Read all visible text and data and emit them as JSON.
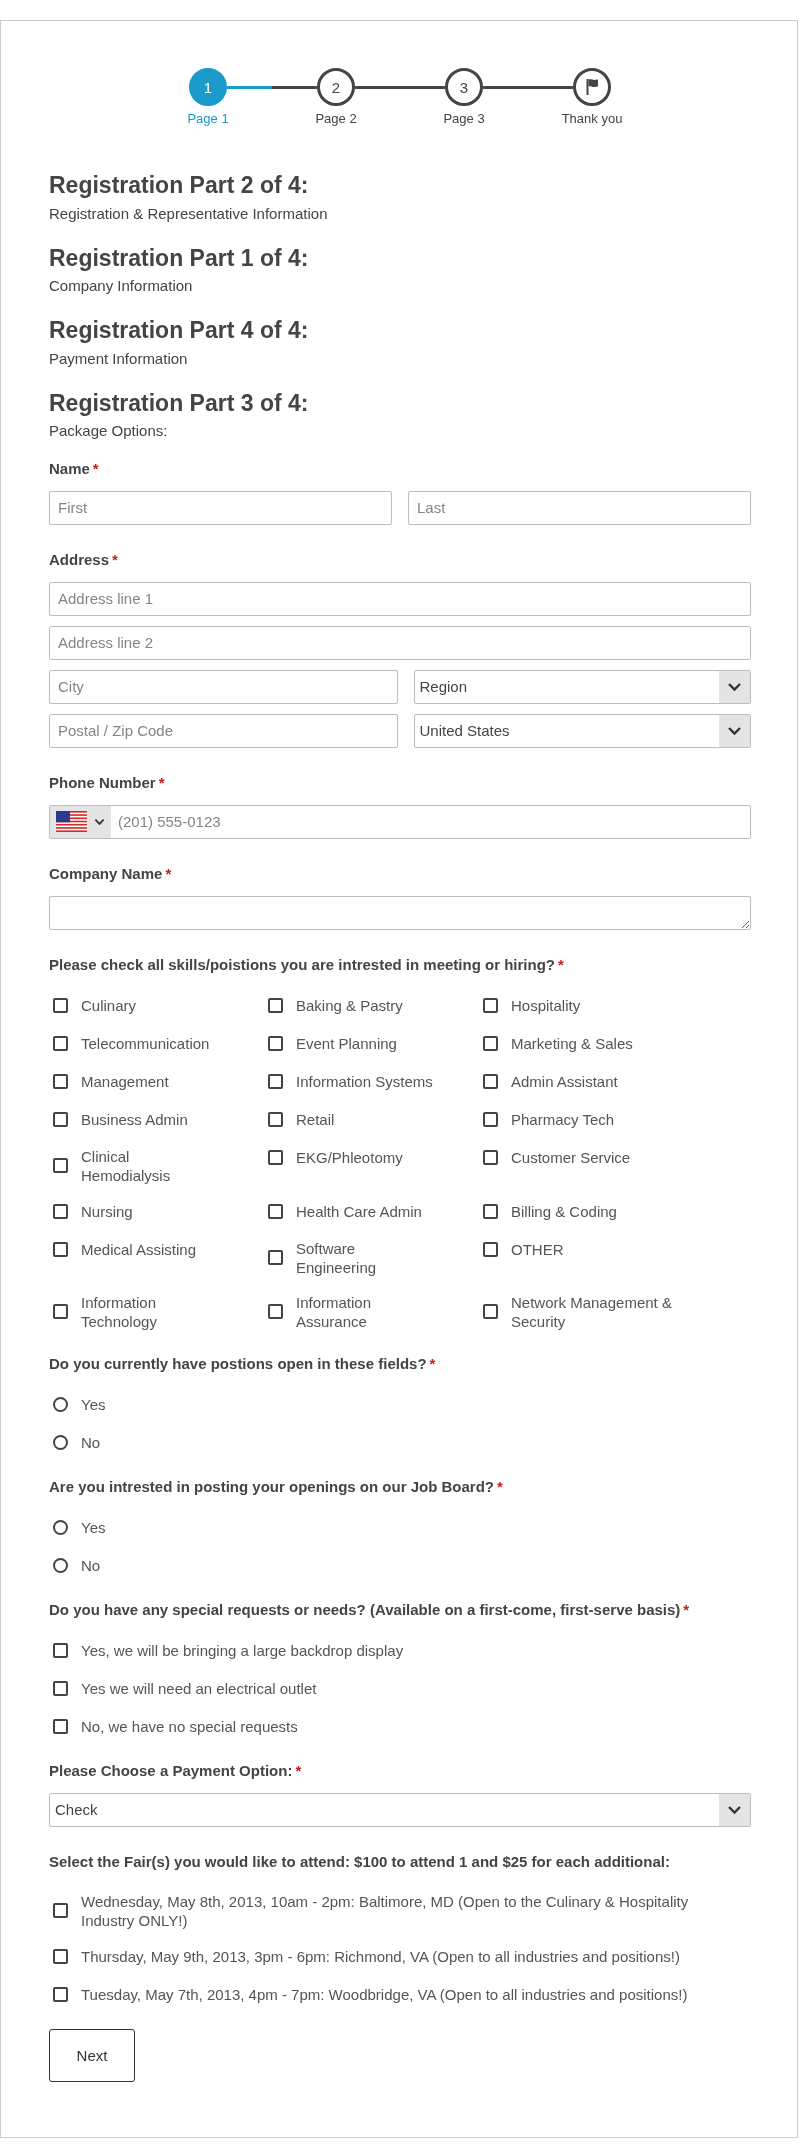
{
  "stepper": {
    "steps": [
      {
        "kind": "number",
        "number": "1",
        "label": "Page 1",
        "selected": true
      },
      {
        "kind": "number",
        "number": "2",
        "label": "Page 2",
        "selected": false
      },
      {
        "kind": "number",
        "number": "3",
        "label": "Page 3",
        "selected": false
      },
      {
        "kind": "flag",
        "label": "Thank you",
        "selected": false
      }
    ]
  },
  "sections": [
    {
      "title": "Registration Part 2 of 4:",
      "subtitle": "Registration & Representative Information"
    },
    {
      "title": "Registration Part 1 of 4:",
      "subtitle": "Company Information"
    },
    {
      "title": "Registration Part 4 of 4:",
      "subtitle": "Payment Information"
    },
    {
      "title": "Registration Part 3 of 4:",
      "subtitle": "Package Options:"
    }
  ],
  "groups": [
    {
      "kind": "inputs",
      "label": "Name",
      "required_mark": "*",
      "rows": [
        [
          {
            "kind": "text",
            "placeholder": "First"
          },
          {
            "kind": "text",
            "placeholder": "Last"
          }
        ]
      ]
    },
    {
      "kind": "inputs",
      "label": "Address",
      "required_mark": "*",
      "rows": [
        [
          {
            "kind": "text",
            "placeholder": "Address line 1"
          }
        ],
        [
          {
            "kind": "text",
            "placeholder": "Address line 2"
          }
        ],
        [
          {
            "kind": "text",
            "placeholder": "City"
          },
          {
            "kind": "select",
            "value": "Region"
          }
        ],
        [
          {
            "kind": "text",
            "placeholder": "Postal / Zip Code"
          },
          {
            "kind": "select",
            "value": "United States"
          }
        ]
      ]
    },
    {
      "kind": "inputs",
      "label": "Phone Number",
      "required_mark": "*",
      "rows": [
        [
          {
            "kind": "phone",
            "placeholder": "(201) 555-0123"
          }
        ]
      ]
    },
    {
      "kind": "inputs",
      "label": "Company Name",
      "required_mark": "*",
      "rows": [
        [
          {
            "kind": "textarea"
          }
        ]
      ]
    },
    {
      "kind": "checkbox-grid",
      "label": "Please check all skills/poistions you are intrested in meeting or hiring?",
      "required_mark": "*",
      "options": [
        {
          "label": "Culinary",
          "checked": false
        },
        {
          "label": "Baking & Pastry",
          "checked": false
        },
        {
          "label": "Hospitality",
          "checked": false
        },
        {
          "label": "Telecommunication",
          "checked": false
        },
        {
          "label": "Event Planning",
          "checked": false
        },
        {
          "label": "Marketing & Sales",
          "checked": false
        },
        {
          "label": "Management",
          "checked": false
        },
        {
          "label": "Information Systems",
          "checked": false
        },
        {
          "label": "Admin Assistant",
          "checked": false
        },
        {
          "label": "Business Admin",
          "checked": false
        },
        {
          "label": "Retail",
          "checked": false
        },
        {
          "label": "Pharmacy Tech",
          "checked": false
        },
        {
          "label": "Clinical Hemodialysis",
          "checked": false
        },
        {
          "label": "EKG/Phleotomy",
          "checked": false
        },
        {
          "label": "Customer Service",
          "checked": false
        },
        {
          "label": "Nursing",
          "checked": false
        },
        {
          "label": "Health Care Admin",
          "checked": false
        },
        {
          "label": "Billing & Coding",
          "checked": false
        },
        {
          "label": "Medical Assisting",
          "checked": false
        },
        {
          "label": "Software Engineering",
          "checked": false
        },
        {
          "label": "OTHER",
          "checked": false
        },
        {
          "label": "Information Technology",
          "checked": false
        },
        {
          "label": "Information Assurance",
          "checked": false
        },
        {
          "label": "Network Management & Security",
          "checked": false
        }
      ]
    },
    {
      "kind": "radio-list",
      "label": "Do you currently have postions open in these fields?",
      "required_mark": "*",
      "options": [
        {
          "label": "Yes",
          "selected": false
        },
        {
          "label": "No",
          "selected": false
        }
      ]
    },
    {
      "kind": "radio-list",
      "label": "Are you intrested in posting your openings on our Job Board?",
      "required_mark": "*",
      "options": [
        {
          "label": "Yes",
          "selected": false
        },
        {
          "label": "No",
          "selected": false
        }
      ]
    },
    {
      "kind": "checkbox-list",
      "label": "Do you have any special requests or needs? (Available on a first-come, first-serve basis)",
      "required_mark": "*",
      "options": [
        {
          "label": "Yes, we will be bringing a large backdrop display",
          "checked": false
        },
        {
          "label": "Yes we will need an electrical outlet",
          "checked": false
        },
        {
          "label": "No, we have no special requests",
          "checked": false
        }
      ]
    },
    {
      "kind": "inputs",
      "label": "Please Choose a Payment Option:",
      "required_mark": "*",
      "rows": [
        [
          {
            "kind": "select",
            "value": "Check"
          }
        ]
      ]
    },
    {
      "kind": "checkbox-list",
      "label": "Select the Fair(s) you would like to attend: $100 to attend 1 and $25 for each additional:",
      "options": [
        {
          "label": "Wednesday, May 8th, 2013, 10am - 2pm: Baltimore, MD (Open to the Culinary & Hospitality Industry ONLY!)",
          "checked": false
        },
        {
          "label": "Thursday, May 9th, 2013, 3pm - 6pm: Richmond, VA (Open to all industries and positions!)",
          "checked": false
        },
        {
          "label": "Tuesday, May 7th, 2013, 4pm - 7pm: Woodbridge, VA (Open to all industries and positions!)",
          "checked": false
        }
      ]
    }
  ],
  "next_button": {
    "label": "Next"
  }
}
